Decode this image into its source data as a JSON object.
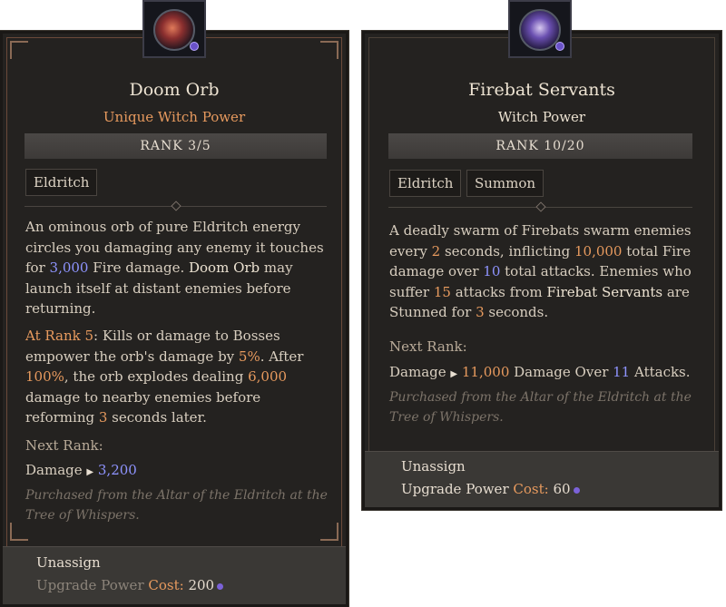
{
  "left_card": {
    "icon": "doom-orb-icon",
    "title": "Doom Orb",
    "subtitle": "Unique Witch Power",
    "rank": "RANK 3/5",
    "tags": [
      "Eldritch"
    ],
    "desc": {
      "p1_a": "An ominous orb of pure Eldritch energy circles you damaging any enemy it touches for ",
      "p1_value": "3,000",
      "p1_b": " Fire damage. ",
      "p1_name": "Doom Orb",
      "p1_c": " may launch itself at distant enemies before returning.",
      "p2_label": "At Rank 5",
      "p2_a": ": Kills or damage to Bosses empower the orb's damage by ",
      "p2_v1": "5%",
      "p2_b": ". After ",
      "p2_v2": "100%",
      "p2_c": ", the orb explodes dealing ",
      "p2_v3": "6,000",
      "p2_d": " damage to nearby enemies before reforming ",
      "p2_v4": "3",
      "p2_e": " seconds later."
    },
    "next_rank_label": "Next Rank:",
    "next_rank_stat": "Damage",
    "next_rank_value": "3,200",
    "flavor": "Purchased from the Altar of the Eldritch at the Tree of Whispers.",
    "footer": {
      "unassign": "Unassign",
      "upgrade": "Upgrade Power",
      "cost_label": "Cost:",
      "cost_value": "200"
    }
  },
  "right_card": {
    "icon": "firebat-servants-icon",
    "title": "Firebat Servants",
    "subtitle": "Witch Power",
    "rank": "RANK 10/20",
    "tags": [
      "Eldritch",
      "Summon"
    ],
    "desc": {
      "a": "A deadly swarm of Firebats swarm enemies every ",
      "v1": "2",
      "b": " seconds, inflicting ",
      "v2": "10,000",
      "c": " total Fire damage over ",
      "v3": "10",
      "d": " total attacks. Enemies who suffer ",
      "v4": "15",
      "e": " attacks from ",
      "name": "Firebat Servants",
      "f": " are Stunned for ",
      "v5": "3",
      "g": " seconds."
    },
    "next_rank_label": "Next Rank:",
    "next_rank_stat": "Damage",
    "next_rank_v1": "11,000",
    "next_rank_mid": " Damage Over ",
    "next_rank_v2": "11",
    "next_rank_end": " Attacks.",
    "flavor": "Purchased from the Altar of the Eldritch at the Tree of Whispers.",
    "footer": {
      "unassign": "Unassign",
      "upgrade": "Upgrade Power",
      "cost_label": "Cost:",
      "cost_value": "60"
    }
  },
  "colors": {
    "accent_blue": "#8f94ff",
    "accent_orange": "#e79a5e",
    "panel_bg": "#242220"
  }
}
